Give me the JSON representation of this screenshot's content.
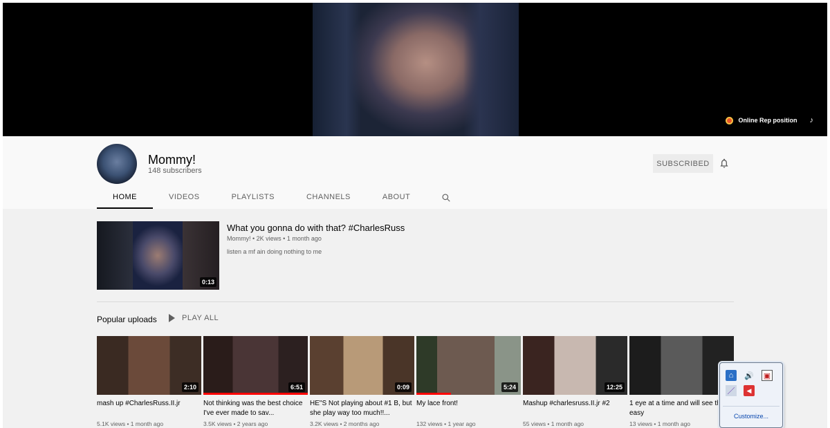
{
  "banner": {
    "link_label": "Online Rep position",
    "tiktok_icon": "tiktok-icon"
  },
  "channel": {
    "name": "Mommy!",
    "subscribers": "148 subscribers",
    "subscribe_label": "SUBSCRIBED",
    "bell_icon": "bell-icon"
  },
  "tabs": [
    {
      "label": "HOME",
      "active": true
    },
    {
      "label": "VIDEOS"
    },
    {
      "label": "PLAYLISTS"
    },
    {
      "label": "CHANNELS"
    },
    {
      "label": "ABOUT"
    }
  ],
  "featured": {
    "title": "What you gonna do with that? #CharlesRuss",
    "meta": "Mommy! • 2K views • 1 month ago",
    "description": "listen a mf ain doing nothing to me",
    "duration": "0:13"
  },
  "shelf": {
    "title": "Popular uploads",
    "play_all": "PLAY ALL"
  },
  "videos": [
    {
      "title": "mash up #CharlesRuss.II.jr",
      "meta": "5.1K views • 1 month ago",
      "duration": "2:10",
      "progress": 0
    },
    {
      "title": "Not thinking was the best choice I've ever made to sav...",
      "meta": "3.5K views • 2 years ago",
      "duration": "6:51",
      "progress": 1.0
    },
    {
      "title": "HE\"S Not playing about #1 B, but she play way too much!!...",
      "meta": "3.2K views • 2 months ago",
      "duration": "0:09",
      "progress": 0
    },
    {
      "title": "My lace front!",
      "meta": "132 views • 1 year ago",
      "duration": "5:24",
      "progress": 0.33
    },
    {
      "title": "Mashup #charlesruss.II.jr #2",
      "meta": "55 views • 1 month ago",
      "duration": "12:25",
      "progress": 0
    },
    {
      "title": "1 eye at a time and will see this is easy",
      "meta": "13 views • 1 month ago",
      "duration": "",
      "progress": 0
    }
  ],
  "tray": {
    "customize_label": "Customize..."
  }
}
